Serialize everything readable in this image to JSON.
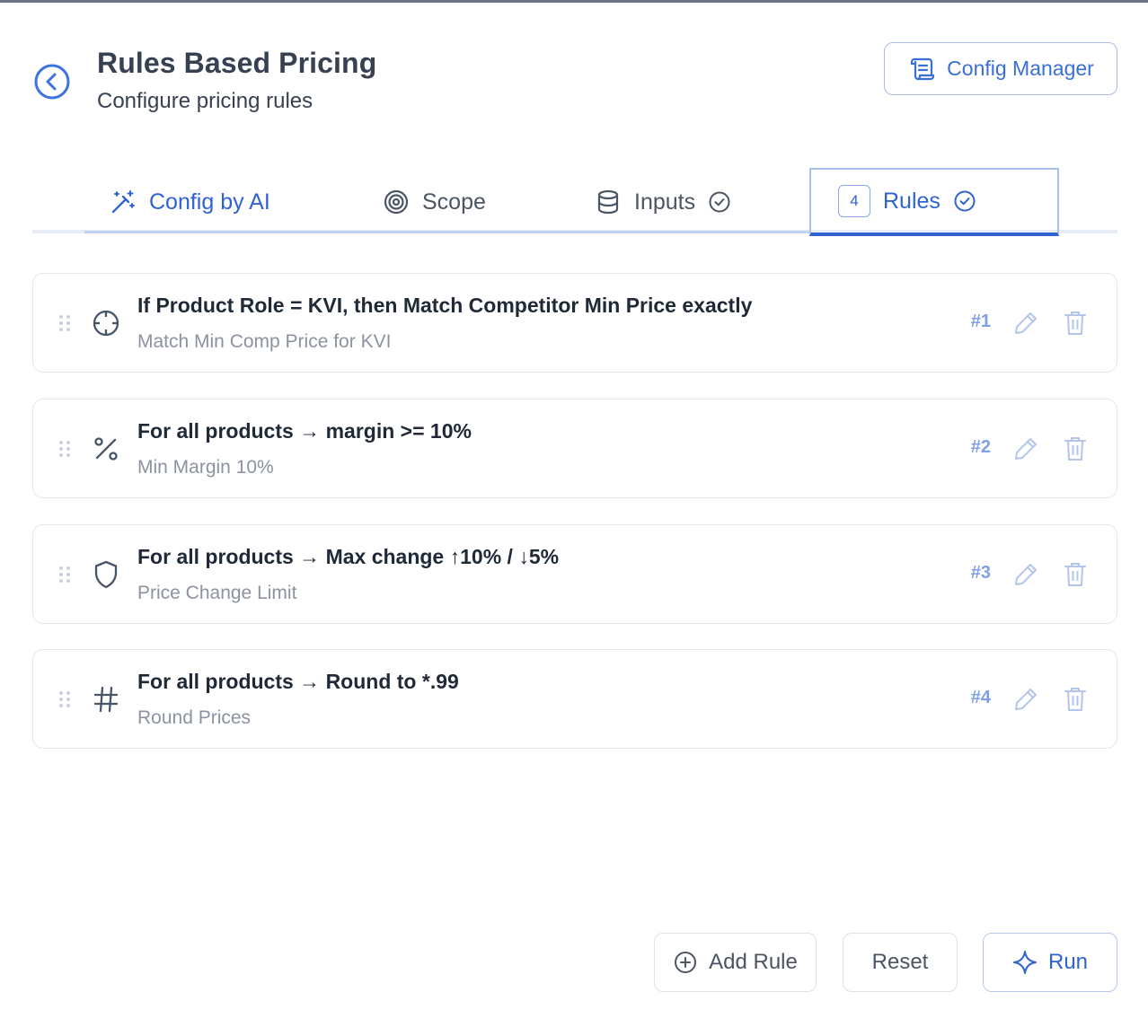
{
  "header": {
    "title": "Rules Based Pricing",
    "subtitle": "Configure pricing rules",
    "config_manager_label": "Config Manager"
  },
  "tabs": [
    {
      "label": "Config by AI",
      "icon": "magic-wand-icon"
    },
    {
      "label": "Scope",
      "icon": "target-icon"
    },
    {
      "label": "Inputs",
      "icon": "database-icon",
      "completed": true
    },
    {
      "label": "Rules",
      "icon": "check-circle-icon",
      "count": "4",
      "completed": true,
      "active": true
    }
  ],
  "rules": [
    {
      "title": "If Product Role = KVI, then Match Competitor Min Price exactly",
      "subtitle": "Match Min Comp Price for KVI",
      "number": "#1",
      "icon": "crosshair-icon"
    },
    {
      "title": "For all products → margin >= 10%",
      "subtitle": "Min Margin 10%",
      "number": "#2",
      "icon": "percent-icon"
    },
    {
      "title": "For all products → Max change ↑10% / ↓5%",
      "subtitle": "Price Change Limit",
      "number": "#3",
      "icon": "shield-icon"
    },
    {
      "title": "For all products → Round to *.99",
      "subtitle": "Round Prices",
      "number": "#4",
      "icon": "hash-icon"
    }
  ],
  "actions": {
    "add_rule_label": "Add Rule",
    "reset_label": "Reset",
    "run_label": "Run"
  },
  "colors": {
    "accent": "#2f63d1",
    "muted_number": "#7fa0e4",
    "border": "#e5e7eb"
  }
}
